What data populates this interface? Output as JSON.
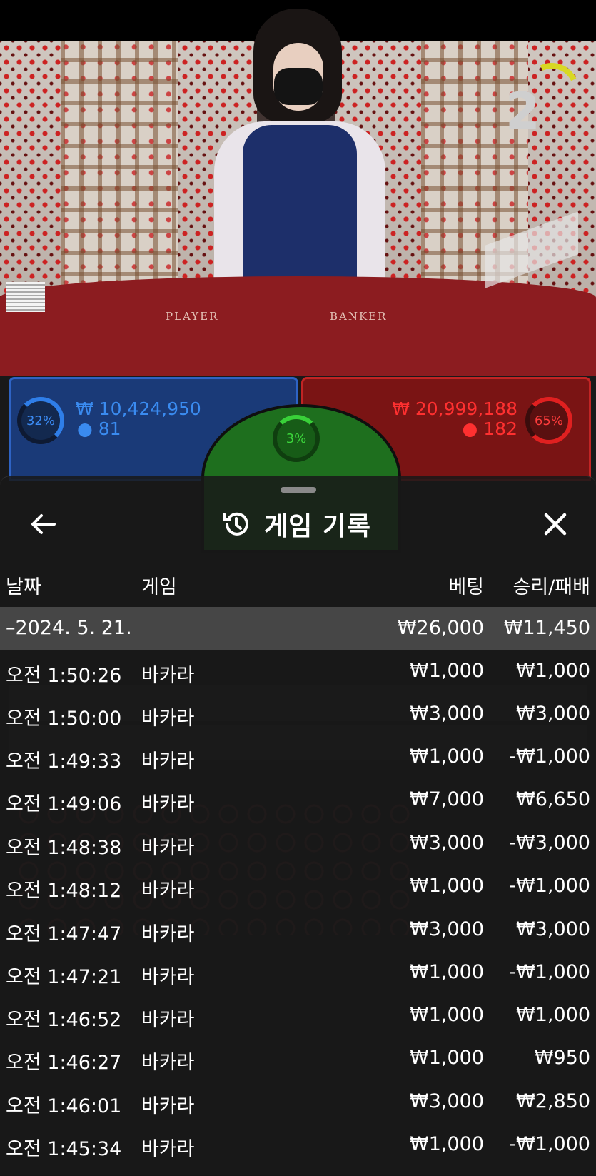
{
  "live": {
    "countdown": "2",
    "table_player_label": "PLAYER",
    "table_banker_label": "BANKER",
    "player": {
      "percent": "32%",
      "amount": "₩ 10,424,950",
      "bettors": "81"
    },
    "banker": {
      "percent": "65%",
      "amount": "₩ 20,999,188",
      "bettors": "182"
    },
    "tie": {
      "percent": "3%"
    }
  },
  "history": {
    "title": "게임 기록",
    "columns": {
      "date": "날짜",
      "game": "게임",
      "bet": "베팅",
      "result": "승리/패배"
    },
    "group": {
      "label": "–2024. 5. 21.",
      "bet_total": "₩26,000",
      "result_total": "₩11,450"
    },
    "rows": [
      {
        "time": "오전 1:50:26",
        "game": "바카라",
        "bet": "₩1,000",
        "result": "₩1,000"
      },
      {
        "time": "오전 1:50:00",
        "game": "바카라",
        "bet": "₩3,000",
        "result": "₩3,000"
      },
      {
        "time": "오전 1:49:33",
        "game": "바카라",
        "bet": "₩1,000",
        "result": "-₩1,000"
      },
      {
        "time": "오전 1:49:06",
        "game": "바카라",
        "bet": "₩7,000",
        "result": "₩6,650"
      },
      {
        "time": "오전 1:48:38",
        "game": "바카라",
        "bet": "₩3,000",
        "result": "-₩3,000"
      },
      {
        "time": "오전 1:48:12",
        "game": "바카라",
        "bet": "₩1,000",
        "result": "-₩1,000"
      },
      {
        "time": "오전 1:47:47",
        "game": "바카라",
        "bet": "₩3,000",
        "result": "₩3,000"
      },
      {
        "time": "오전 1:47:21",
        "game": "바카라",
        "bet": "₩1,000",
        "result": "-₩1,000"
      },
      {
        "time": "오전 1:46:52",
        "game": "바카라",
        "bet": "₩1,000",
        "result": "₩1,000"
      },
      {
        "time": "오전 1:46:27",
        "game": "바카라",
        "bet": "₩1,000",
        "result": "₩950"
      },
      {
        "time": "오전 1:46:01",
        "game": "바카라",
        "bet": "₩3,000",
        "result": "₩2,850"
      },
      {
        "time": "오전 1:45:34",
        "game": "바카라",
        "bet": "₩1,000",
        "result": "-₩1,000"
      }
    ]
  },
  "icons": {
    "back": "arrow-left-icon",
    "history": "history-clock-icon",
    "close": "close-icon",
    "bettors": "person-icon"
  }
}
